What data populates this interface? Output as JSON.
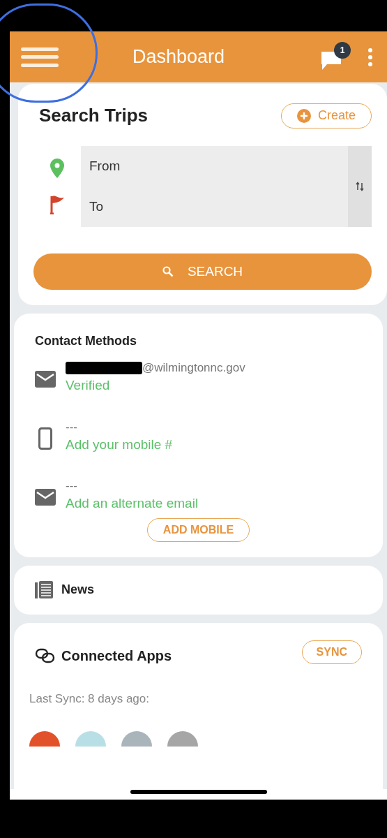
{
  "header": {
    "title": "Dashboard",
    "badge": "1"
  },
  "search_trips": {
    "title": "Search Trips",
    "create_button": "Create",
    "from": {
      "placeholder": "From"
    },
    "to": {
      "placeholder": "To"
    },
    "search_button": "SEARCH"
  },
  "contact_methods": {
    "title": "Contact Methods",
    "items": [
      {
        "kind": "email",
        "value": "@wilmingtonnc.gov",
        "redacted": true,
        "action": "Verified"
      },
      {
        "kind": "mobile",
        "value": "---",
        "redacted": false,
        "action": "Add your mobile #"
      },
      {
        "kind": "email",
        "value": "---",
        "redacted": false,
        "action": "Add an alternate email"
      }
    ],
    "button": "ADD MOBILE"
  },
  "news": {
    "title": "News"
  },
  "connected_apps": {
    "title": "Connected Apps",
    "sync_button": "SYNC",
    "last_sync": "Last Sync: 8 days ago:",
    "apps": [
      {
        "color": "#e2522a"
      },
      {
        "color": "#b9dfe6"
      },
      {
        "color": "#a9b4bb"
      },
      {
        "color": "#a6a6a6"
      }
    ]
  }
}
